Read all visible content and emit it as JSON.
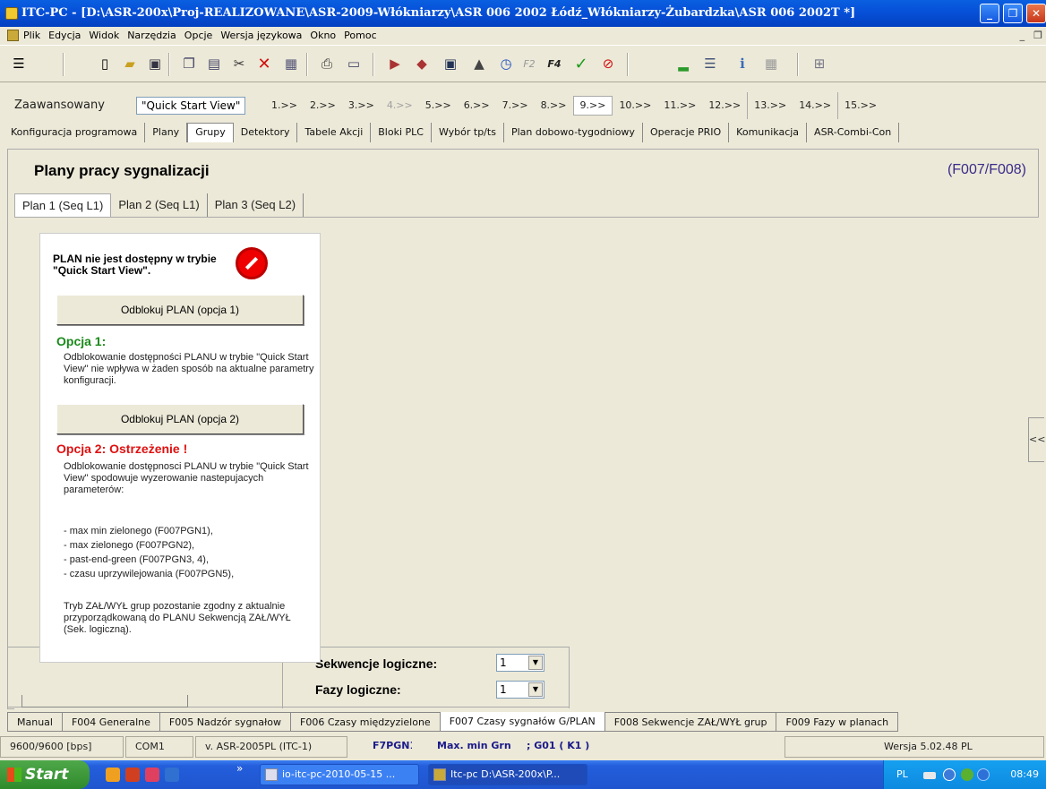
{
  "window": {
    "title": "ITC-PC  - [D:\\ASR-200x\\Proj-REALIZOWANE\\ASR-2009-Włókniarzy\\ASR 006 2002 Łódź_Włókniarzy-Żubardzka\\ASR 006 2002T *]",
    "btn_min": "_",
    "btn_max": "❐",
    "btn_close": "✕"
  },
  "menu": {
    "items": [
      "Plik",
      "Edycja",
      "Widok",
      "Narzędzia",
      "Opcje",
      "Wersja językowa",
      "Okno",
      "Pomoc"
    ],
    "ctl_min": "_",
    "ctl_restore": "❐"
  },
  "toolbar": {
    "icons": [
      "settings-icon",
      "new-file-icon",
      "open-folder-icon",
      "save-icon",
      "copy-icon",
      "paste-icon",
      "cut-icon",
      "delete-icon",
      "view-icon",
      "print-icon",
      "export-icon",
      "import-icon",
      "transfer-icon",
      "monitor-icon",
      "upload-icon",
      "clock-icon",
      "f2-icon",
      "f4-icon",
      "check-icon",
      "cancel-icon",
      "battery-icon",
      "list-icon",
      "info-icon",
      "grid-icon",
      "structure-icon"
    ],
    "f2_label": "F2",
    "f4_label": "F4"
  },
  "stepbar": {
    "mode_label": "Zaawansowany",
    "view_value": "\"Quick Start View\"",
    "steps": [
      "1.>>",
      "2.>>",
      "3.>>",
      "4.>>",
      "5.>>",
      "6.>>",
      "7.>>",
      "8.>>",
      "9.>>",
      "10.>>",
      "11.>>",
      "12.>>",
      "13.>>",
      "14.>>",
      "15.>>"
    ],
    "disabled_step": "4.>>",
    "active_step": "9.>>"
  },
  "main_tabs": [
    "Konfiguracja programowa",
    "Plany",
    "Grupy",
    "Detektory",
    "Tabele Akcji",
    "Bloki PLC",
    "Wybór tp/ts",
    "Plan dobowo-tygodniowy",
    "Operacje PRIO",
    "Komunikacja",
    "ASR-Combi-Con"
  ],
  "main_tabs_active": "Grupy",
  "panel": {
    "title": "Plany pracy sygnalizacji",
    "code": "(F007/F008)"
  },
  "plan_tabs": [
    "Plan 1 (Seq L1)",
    "Plan 2 (Seq L1)",
    "Plan 3 (Seq L2)"
  ],
  "plan_tabs_active": "Plan 1 (Seq L1)",
  "collapse_label": "<<",
  "popup": {
    "heading": "PLAN nie jest dostępny w trybie \"Quick Start View\".",
    "btn1": "Odblokuj PLAN (opcja 1)",
    "opt1_title": "Opcja 1:",
    "opt1_text": "Odblokowanie dostępności PLANU w trybie \"Quick Start View\" nie wpływa w żaden sposób na aktualne parametry konfiguracji.",
    "btn2": "Odblokuj PLAN (opcja 2)",
    "opt2_title": "Opcja 2: Ostrzeżenie !",
    "opt2_text": "Odblokowanie dostępnosci PLANU w trybie \"Quick Start View\" spodowuje wyzerowanie nastepujacych parameterów:",
    "params": [
      "- max min zielonego (F007PGN1),",
      "- max zielonego (F007PGN2),",
      "- past-end-green (F007PGN3, 4),",
      "- czasu uprzywilejowania (F007PGN5),"
    ],
    "footer": "Tryb ZAŁ/WYŁ grup pozostanie zgodny z aktualnie przyporządkowaną do PLANU Sekwencją ZAŁ/WYŁ (Sek. logiczną)."
  },
  "bottom": {
    "seq_label": "Sekwencje logiczne:",
    "seq_value": "1",
    "faz_label": "Fazy logiczne:",
    "faz_value": "1"
  },
  "bottom_tabs": [
    "Manual",
    "F004 Generalne",
    "F005 Nadzór sygnałow",
    "F006 Czasy międzyzielone",
    "F007 Czasy sygnałów G/PLAN",
    "F008 Sekwencje ZAŁ/WYŁ grup",
    "F009 Fazy w planach"
  ],
  "bottom_tabs_active": "F007 Czasy sygnałów G/PLAN",
  "status": {
    "baud": "9600/9600 [bps]",
    "port": "COM1",
    "version": "v. ASR-2005PL (ITC-1)",
    "param": "F7PGN1",
    "param_name": "Max. min Grn",
    "group": "; G01 ( K1  )",
    "build": "Wersja 5.02.48 PL"
  },
  "taskbar": {
    "start": "Start",
    "task1": "io-itc-pc-2010-05-15 ...",
    "task2": "Itc-pc D:\\ASR-200x\\P...",
    "lang": "PL",
    "clock": "08:49",
    "overflow": "»"
  }
}
